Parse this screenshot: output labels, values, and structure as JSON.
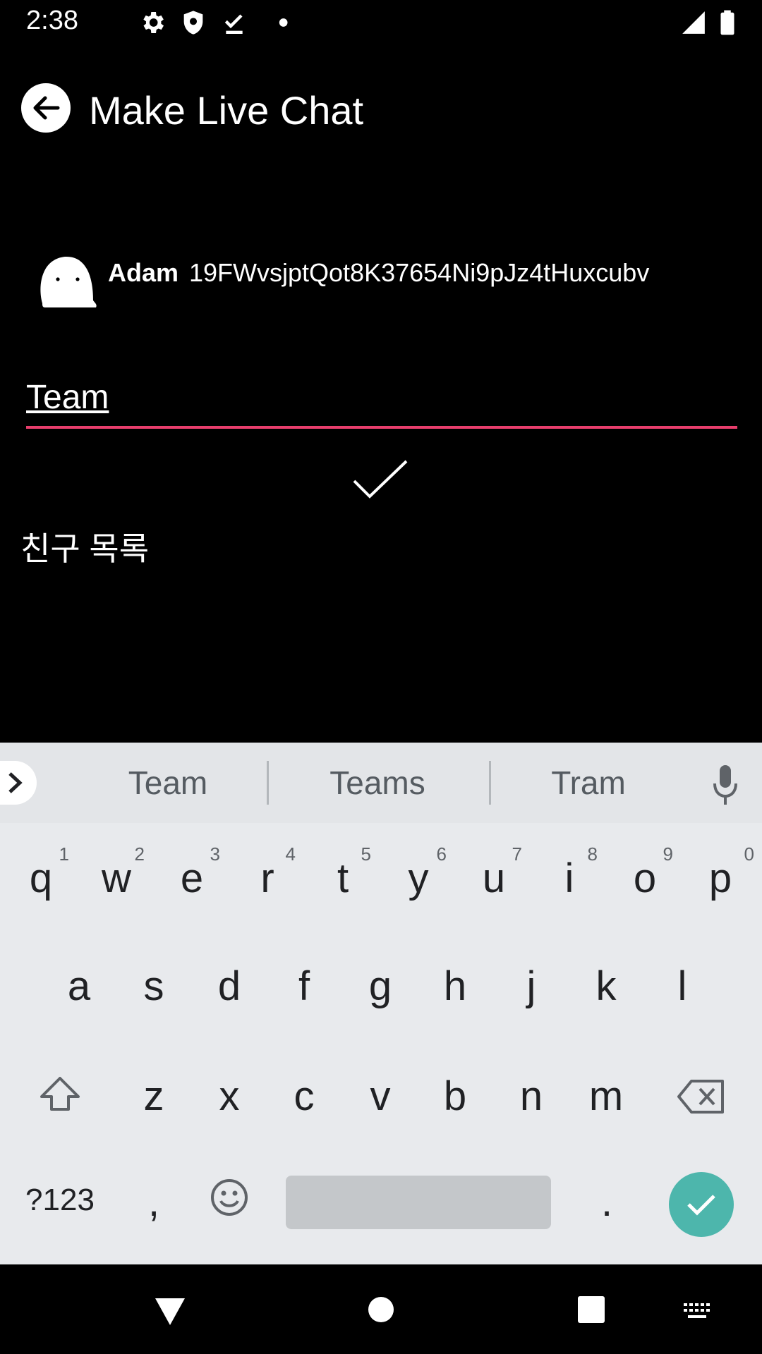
{
  "status_bar": {
    "time": "2:38",
    "icons": [
      "gear-icon",
      "shield-icon",
      "download-done-icon",
      "dot-icon",
      "signal-icon",
      "battery-icon"
    ]
  },
  "app_bar": {
    "title": "Make Live Chat",
    "back_icon": "arrow-back-icon"
  },
  "profile": {
    "name": "Adam",
    "id": "19FWvsjptQot8K37654Ni9pJz4tHuxcubv"
  },
  "chat_name_input": {
    "value": "Team",
    "underline_color": "#e83e6c"
  },
  "friend_list_label": "친구 목록",
  "keyboard": {
    "suggestions": [
      "Team",
      "Teams",
      "Tram"
    ],
    "row1": [
      {
        "ch": "q",
        "num": "1"
      },
      {
        "ch": "w",
        "num": "2"
      },
      {
        "ch": "e",
        "num": "3"
      },
      {
        "ch": "r",
        "num": "4"
      },
      {
        "ch": "t",
        "num": "5"
      },
      {
        "ch": "y",
        "num": "6"
      },
      {
        "ch": "u",
        "num": "7"
      },
      {
        "ch": "i",
        "num": "8"
      },
      {
        "ch": "o",
        "num": "9"
      },
      {
        "ch": "p",
        "num": "0"
      }
    ],
    "row2": [
      "a",
      "s",
      "d",
      "f",
      "g",
      "h",
      "j",
      "k",
      "l"
    ],
    "row3": [
      "z",
      "x",
      "c",
      "v",
      "b",
      "n",
      "m"
    ],
    "symbols_label": "?123",
    "comma": ",",
    "period": ".",
    "enter_color": "#4db6ac"
  }
}
